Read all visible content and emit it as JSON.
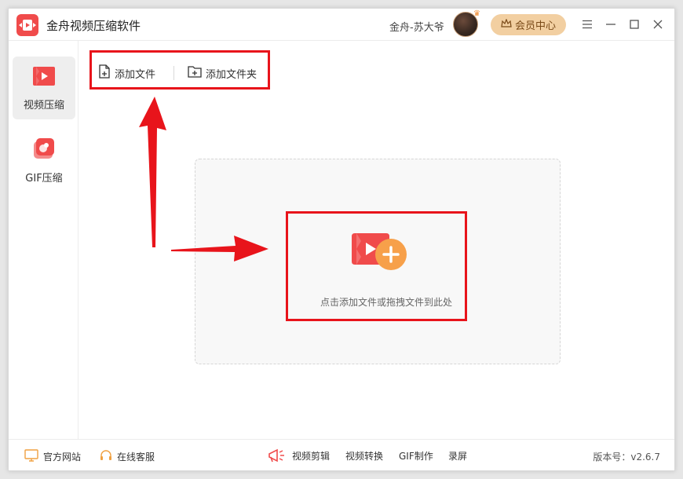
{
  "app": {
    "title": "金舟视频压缩软件"
  },
  "header": {
    "username": "金舟-苏大爷",
    "vip_label": "会员中心"
  },
  "sidebar": {
    "items": [
      {
        "label": "视频压缩"
      },
      {
        "label": "GIF压缩"
      }
    ]
  },
  "toolbar": {
    "add_file": "添加文件",
    "add_folder": "添加文件夹"
  },
  "dropzone": {
    "hint": "点击添加文件或拖拽文件到此处"
  },
  "footer": {
    "left": [
      {
        "label": "官方网站"
      },
      {
        "label": "在线客服"
      }
    ],
    "tools": [
      {
        "label": "视频剪辑"
      },
      {
        "label": "视频转换"
      },
      {
        "label": "GIF制作"
      },
      {
        "label": "录屏"
      }
    ],
    "version": "版本号：v2.6.7"
  },
  "colors": {
    "accent": "#f04b4b",
    "annotation": "#e8141b",
    "vip_bg": "#f2cfa1",
    "plus_orange": "#f7a04a"
  }
}
